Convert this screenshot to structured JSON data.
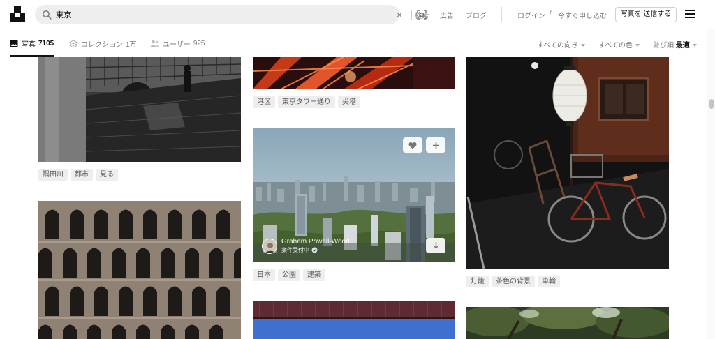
{
  "header": {
    "search_value": "東京",
    "nav_links": [
      "検索",
      "広告",
      "ブログ"
    ],
    "login": "ログイン",
    "slash": "/",
    "signup": "今すぐ申し込む",
    "submit_photo": "写真を 送信する"
  },
  "filters": {
    "tabs": [
      {
        "label": "写真",
        "count": "7105"
      },
      {
        "label": "コレクション",
        "count": "1万"
      },
      {
        "label": "ユーザー",
        "count": "925"
      }
    ],
    "orientation": "すべての向き",
    "color": "すべての色",
    "sort_label": "並び順",
    "sort_value": "最適"
  },
  "photos": {
    "p1_tags": [
      "隅田川",
      "都市",
      "見る"
    ],
    "p2_tags": [
      "港区",
      "東京タワー通り",
      "尖塔"
    ],
    "p3_tags": [
      "日本",
      "公園",
      "建築"
    ],
    "p4_tags": [
      "灯籠",
      "茶色の背景",
      "車輪"
    ],
    "p3_author_name": "Graham Powell-Wood",
    "p3_author_status": "案件受付中"
  },
  "colors": {
    "accent": "#111111",
    "tag_bg": "#eeeeee",
    "search_bg": "#eeeeee"
  }
}
